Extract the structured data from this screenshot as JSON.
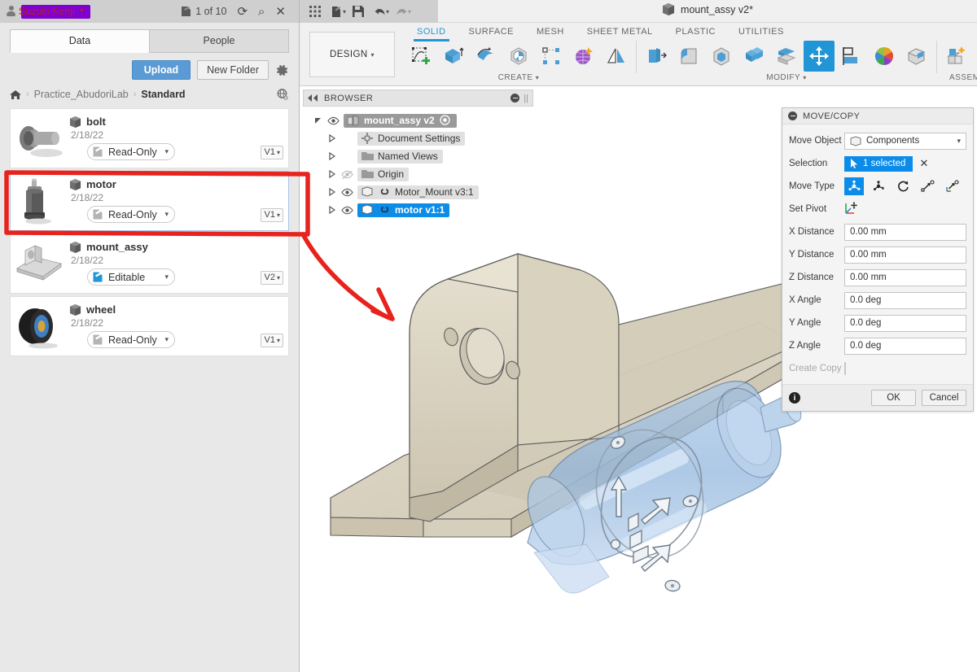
{
  "data_panel": {
    "user": {
      "name": "Suzuki Kenji",
      "caret": "▾",
      "icon": "person-icon"
    },
    "counter": {
      "label": "1 of 10",
      "icon": "document-icon"
    },
    "titlebar_icons": {
      "refresh": "⟳",
      "search": "⌕",
      "close": "✕"
    },
    "tabs": [
      {
        "label": "Data",
        "active": true
      },
      {
        "label": "People",
        "active": false
      }
    ],
    "actions": {
      "upload": "Upload",
      "new_folder": "New Folder",
      "settings_icon": "gear-icon"
    },
    "breadcrumb": {
      "home_icon": "home-icon",
      "sep": "›",
      "project": "Practice_AbudoriLab",
      "current": "Standard",
      "globe_icon": "globe-icon"
    },
    "items": [
      {
        "name": "bolt",
        "date": "2/18/22",
        "status": "Read-Only",
        "version": "V1",
        "editable": false,
        "selected": false
      },
      {
        "name": "motor",
        "date": "2/18/22",
        "status": "Read-Only",
        "version": "V1",
        "editable": false,
        "selected": true
      },
      {
        "name": "mount_assy",
        "date": "2/18/22",
        "status": "Editable",
        "version": "V2",
        "editable": true,
        "selected": false
      },
      {
        "name": "wheel",
        "date": "2/18/22",
        "status": "Read-Only",
        "version": "V1",
        "editable": false,
        "selected": false
      }
    ]
  },
  "quick_access": {
    "grid_icon": "app-grid-icon",
    "new_icon": "new-document-icon",
    "save_icon": "save-icon",
    "undo_icon": "undo-icon",
    "redo_icon": "redo-icon",
    "caret": "▾"
  },
  "document_tab": {
    "title": "mount_assy v2*",
    "icon": "cube-icon"
  },
  "ribbon": {
    "workspace": {
      "label": "DESIGN",
      "caret": "▾"
    },
    "tabs": [
      {
        "label": "SOLID",
        "active": true
      },
      {
        "label": "SURFACE",
        "active": false
      },
      {
        "label": "MESH",
        "active": false
      },
      {
        "label": "SHEET METAL",
        "active": false
      },
      {
        "label": "PLASTIC",
        "active": false
      },
      {
        "label": "UTILITIES",
        "active": false
      }
    ],
    "groups": [
      {
        "label": "CREATE",
        "caret": "▾",
        "tools": [
          {
            "name": "create-sketch-icon",
            "active": false
          },
          {
            "name": "extrude-icon",
            "active": false
          },
          {
            "name": "revolve-icon",
            "active": false
          },
          {
            "name": "sweep-icon",
            "active": false
          },
          {
            "name": "pattern-icon",
            "active": false
          },
          {
            "name": "create-form-icon",
            "active": false
          },
          {
            "name": "mirror-icon",
            "active": false
          }
        ]
      },
      {
        "label": "MODIFY",
        "caret": "▾",
        "tools": [
          {
            "name": "press-pull-icon",
            "active": false
          },
          {
            "name": "fillet-icon",
            "active": false
          },
          {
            "name": "shell-icon",
            "active": false
          },
          {
            "name": "combine-icon",
            "active": false
          },
          {
            "name": "offset-face-icon",
            "active": false
          },
          {
            "name": "move-copy-icon",
            "active": true
          },
          {
            "name": "align-icon",
            "active": false
          },
          {
            "name": "appearance-icon",
            "active": false
          },
          {
            "name": "physical-material-icon",
            "active": false
          }
        ]
      },
      {
        "label": "ASSEMBLE",
        "caret": "",
        "tools": [
          {
            "name": "new-component-icon",
            "active": false
          },
          {
            "name": "joint-icon",
            "active": false
          }
        ]
      }
    ]
  },
  "browser": {
    "title": "BROWSER",
    "collapse_icon": "collapse-left-icon",
    "minimize_icon": "minus-circle-icon",
    "grip_icon": "grip-icon",
    "nodes": [
      {
        "label": "mount_assy v2",
        "indent": 0,
        "state": "root",
        "expander": "open",
        "eye": true,
        "icon": "assembly-icon",
        "suffix_icon": "target-icon"
      },
      {
        "label": "Document Settings",
        "indent": 1,
        "state": "normal",
        "expander": "closed",
        "eye": false,
        "icon": "gear-icon",
        "suffix_icon": ""
      },
      {
        "label": "Named Views",
        "indent": 1,
        "state": "normal",
        "expander": "closed",
        "eye": false,
        "icon": "folder-icon",
        "suffix_icon": ""
      },
      {
        "label": "Origin",
        "indent": 1,
        "state": "normal",
        "expander": "closed",
        "eye": "off",
        "icon": "folder-icon",
        "suffix_icon": ""
      },
      {
        "label": "Motor_Mount v3:1",
        "indent": 1,
        "state": "normal",
        "expander": "closed",
        "eye": true,
        "icon": "component-icon",
        "suffix_icon": "link-icon"
      },
      {
        "label": "motor v1:1",
        "indent": 1,
        "state": "selected",
        "expander": "closed",
        "eye": true,
        "icon": "component-icon",
        "suffix_icon": "link-icon"
      }
    ]
  },
  "move_copy_dialog": {
    "title": "MOVE/COPY",
    "minimize_icon": "minus-circle-icon",
    "fields": [
      {
        "label": "Move Object",
        "type": "select",
        "value": "Components",
        "icon": "component-icon",
        "caret": "▾"
      },
      {
        "label": "Selection",
        "type": "selection",
        "value": "1 selected",
        "clear": "✕"
      },
      {
        "label": "Move Type",
        "type": "movetype",
        "options": [
          {
            "name": "free-move-icon",
            "active": true
          },
          {
            "name": "translate-axis-icon",
            "active": false
          },
          {
            "name": "rotate-icon",
            "active": false
          },
          {
            "name": "point-to-point-icon",
            "active": false
          },
          {
            "name": "point-to-position-icon",
            "active": false
          }
        ]
      },
      {
        "label": "Set Pivot",
        "type": "pivot",
        "icon": "set-pivot-icon"
      },
      {
        "label": "X Distance",
        "type": "input",
        "value": "0.00 mm"
      },
      {
        "label": "Y Distance",
        "type": "input",
        "value": "0.00 mm"
      },
      {
        "label": "Z Distance",
        "type": "input",
        "value": "0.00 mm"
      },
      {
        "label": "X Angle",
        "type": "input",
        "value": "0.0 deg"
      },
      {
        "label": "Y Angle",
        "type": "input",
        "value": "0.0 deg"
      },
      {
        "label": "Z Angle",
        "type": "input",
        "value": "0.0 deg"
      },
      {
        "label": "Create Copy",
        "type": "checkbox",
        "checked": false,
        "disabled": true
      }
    ],
    "footer": {
      "info_icon": "info-icon",
      "info_glyph": "i",
      "ok": "OK",
      "cancel": "Cancel"
    }
  },
  "viewport": {
    "background": "#ffffff",
    "parts": [
      {
        "name": "mount_assy-bracket",
        "color": "#ded8c8",
        "selected": false
      },
      {
        "name": "motor-body",
        "color": "#8fb5dd",
        "selected": true
      }
    ],
    "manipulator": {
      "name": "move-manipulator",
      "color": "#ffffff"
    }
  },
  "annotation": {
    "color": "#e8221c",
    "shapes": [
      "highlight-rectangle-around-motor",
      "curved-arrow-to-viewport"
    ]
  },
  "colors": {
    "accent_blue": "#0c8ce9",
    "tab_blue": "#2196d6",
    "upload_blue": "#5b9bd5",
    "panel_gray": "#e8e8e8",
    "titlebar_gray": "#cfcfcf",
    "ribbon_gray": "#f0f0f0",
    "annotation_red": "#e8221c",
    "redaction_purple": "#8000d0",
    "part_tan": "#ded8c8",
    "part_blue": "#8fb5dd"
  }
}
